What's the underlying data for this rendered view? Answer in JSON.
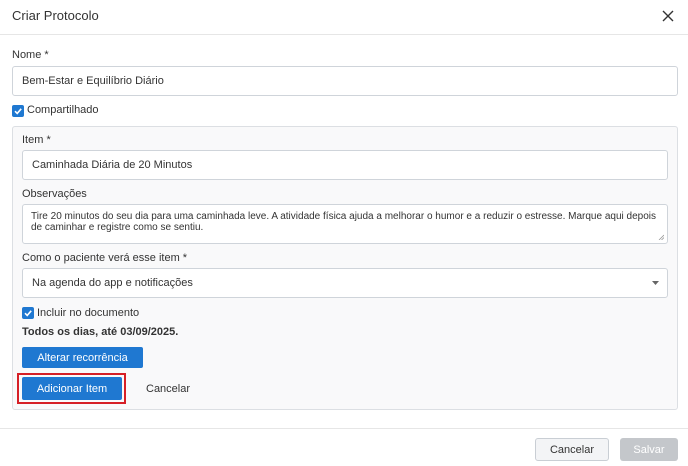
{
  "dialog": {
    "title": "Criar Protocolo"
  },
  "form": {
    "name_label": "Nome *",
    "name_value": "Bem-Estar e Equilíbrio Diário",
    "shared_label": "Compartilhado",
    "shared_checked": true
  },
  "item": {
    "item_label": "Item *",
    "item_value": "Caminhada Diária de 20 Minutos",
    "notes_label": "Observações",
    "notes_value": "Tire 20 minutos do seu dia para uma caminhada leve. A atividade física ajuda a melhorar o humor e a reduzir o estresse. Marque aqui depois de caminhar e registre como se sentiu.",
    "view_label": "Como o paciente verá esse item *",
    "view_value": "Na agenda do app e notificações",
    "include_label": "Incluir no documento",
    "include_checked": true,
    "recurrence_text": "Todos os dias, até 03/09/2025.",
    "change_recurrence_label": "Alterar recorrência",
    "add_item_label": "Adicionar Item",
    "cancel_label": "Cancelar"
  },
  "footer": {
    "cancel_label": "Cancelar",
    "save_label": "Salvar"
  },
  "colors": {
    "primary": "#1f78d1",
    "highlight": "#d61f26",
    "disabled": "#c4c7cb"
  }
}
